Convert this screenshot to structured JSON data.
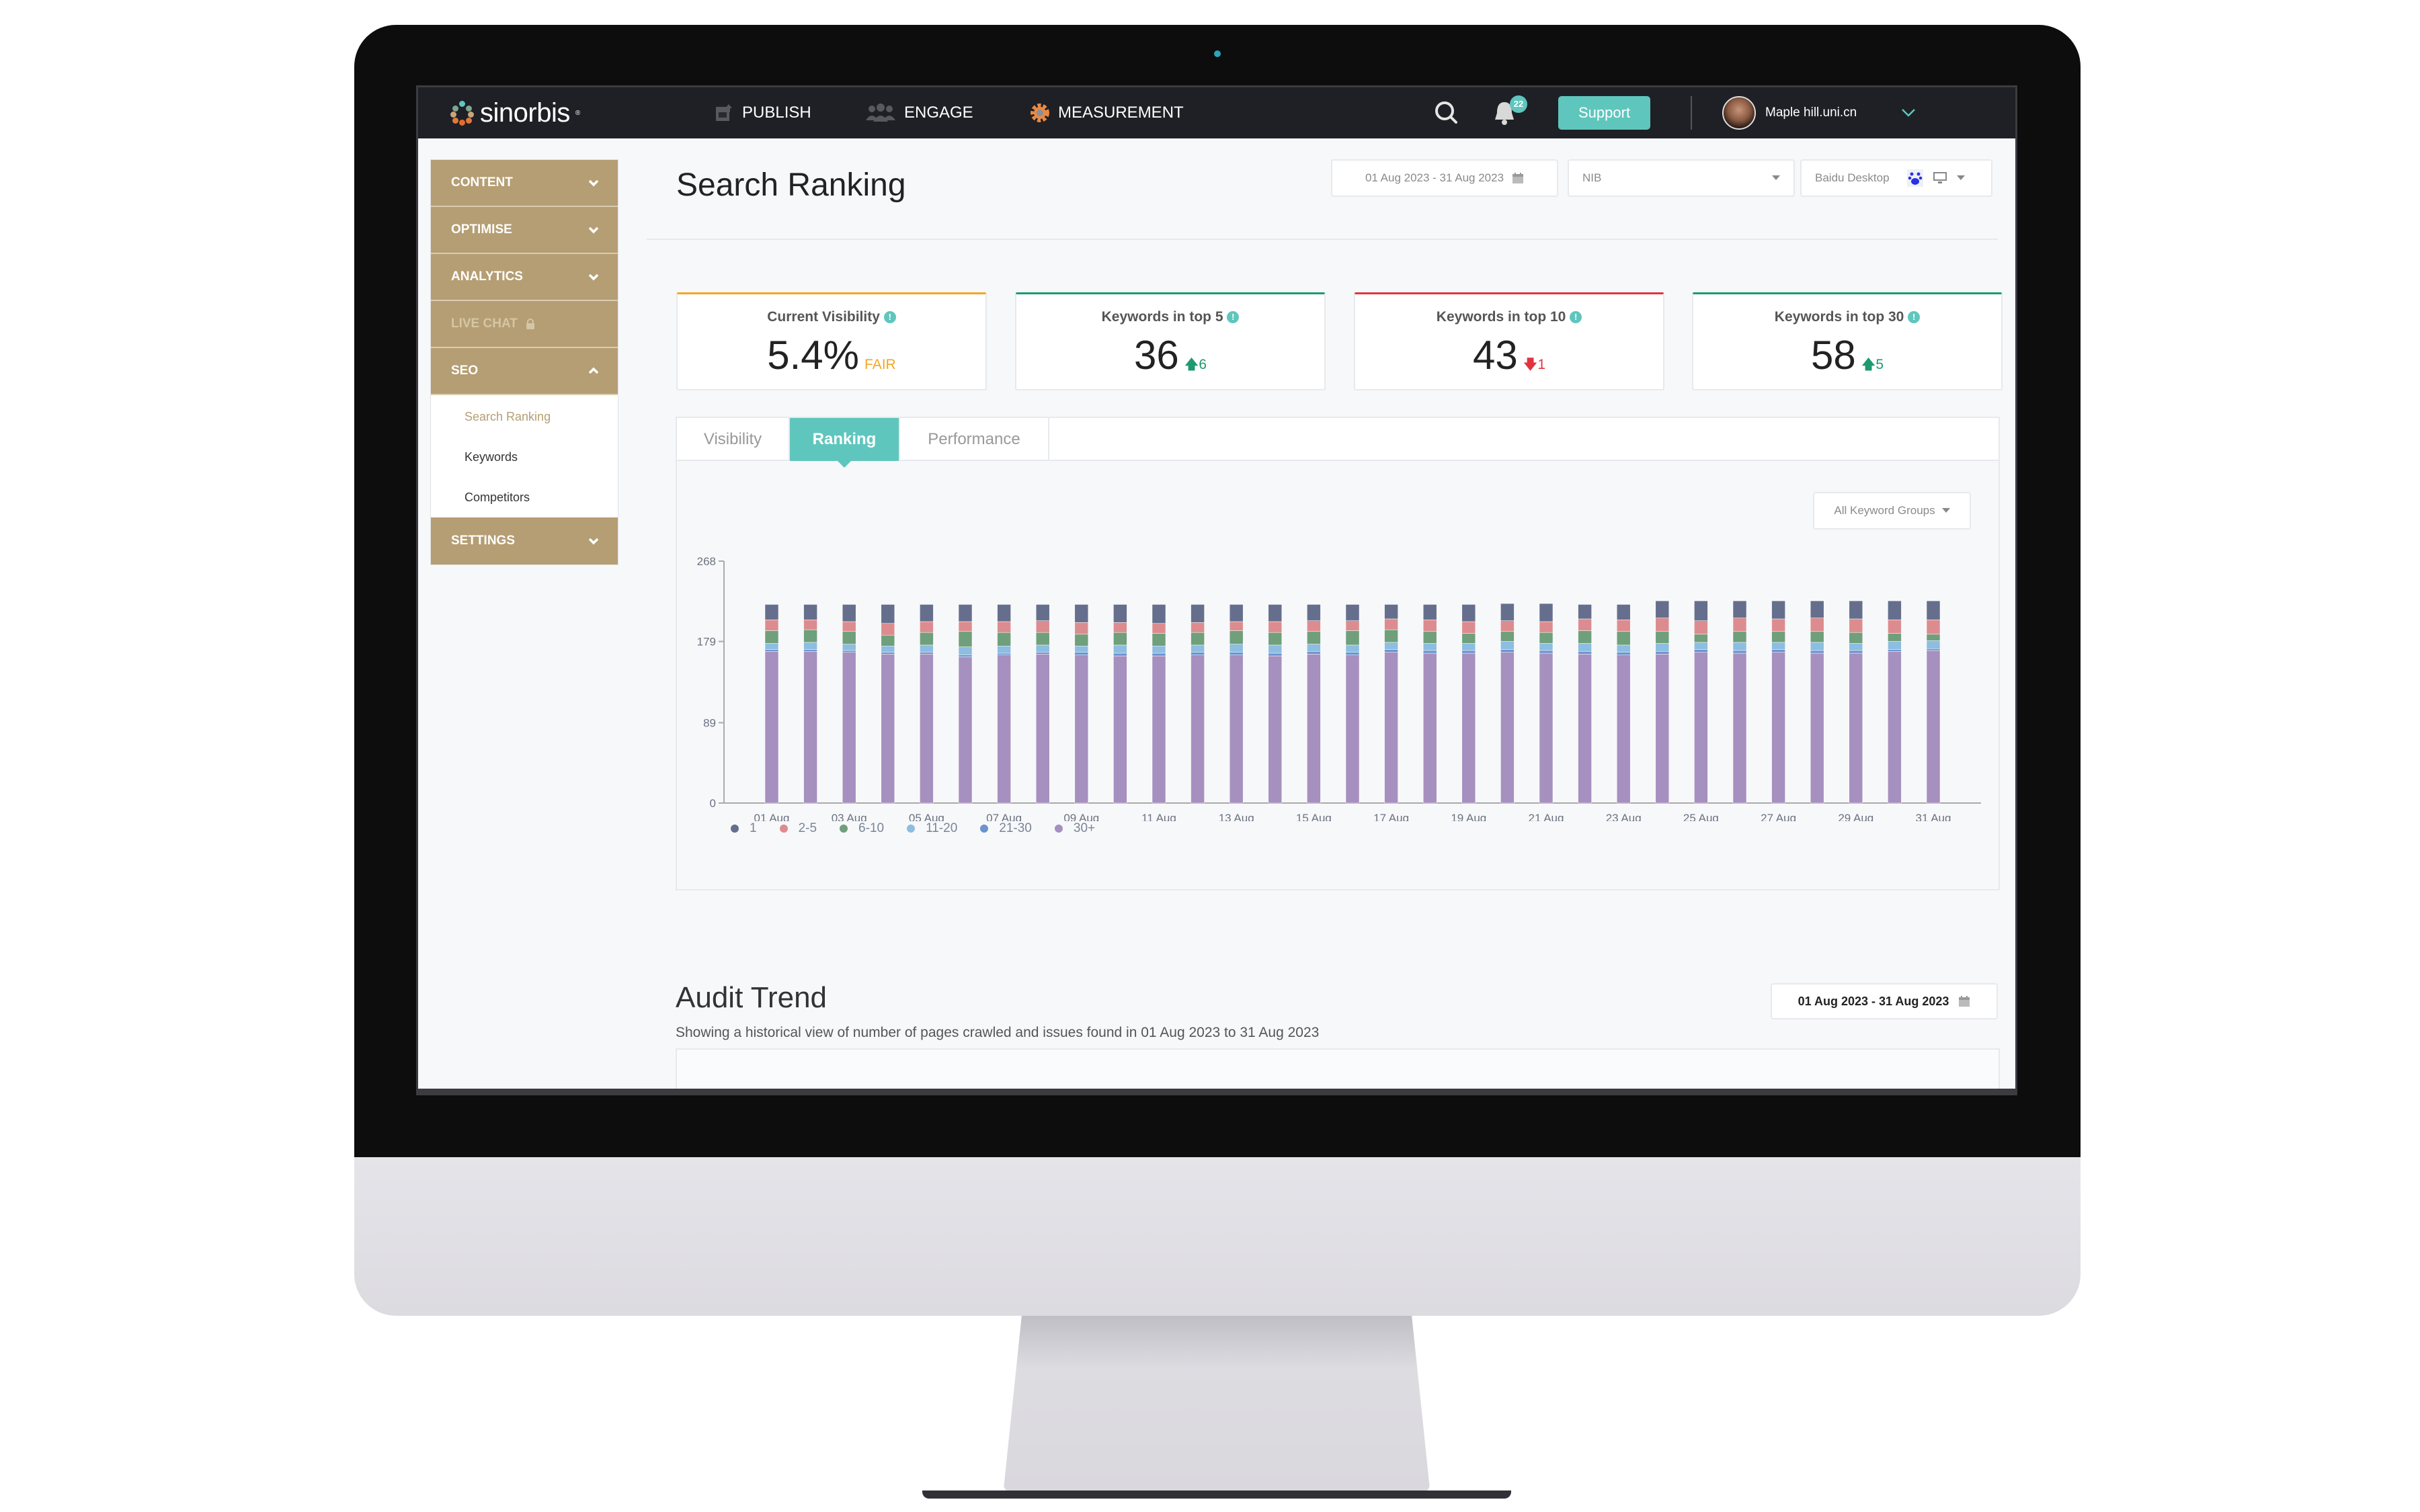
{
  "topnav": {
    "brand": "sinorbis",
    "brand_mark": "®",
    "items": [
      {
        "label": "PUBLISH",
        "icon": "publish-icon"
      },
      {
        "label": "ENGAGE",
        "icon": "engage-icon"
      },
      {
        "label": "MEASUREMENT",
        "icon": "gear-icon"
      }
    ],
    "notifications_count": "22",
    "support_label": "Support",
    "user_name": "Maple hill.uni.cn"
  },
  "sidebar": {
    "items": [
      {
        "label": "CONTENT",
        "state": "collapsed"
      },
      {
        "label": "OPTIMISE",
        "state": "collapsed"
      },
      {
        "label": "ANALYTICS",
        "state": "collapsed"
      },
      {
        "label": "LIVE CHAT",
        "state": "locked"
      },
      {
        "label": "SEO",
        "state": "expanded"
      },
      {
        "label": "SETTINGS",
        "state": "collapsed"
      }
    ],
    "seo_subitems": [
      {
        "label": "Search Ranking",
        "active": true
      },
      {
        "label": "Keywords",
        "active": false
      },
      {
        "label": "Competitors",
        "active": false
      }
    ]
  },
  "page": {
    "title": "Search Ranking",
    "filters": {
      "date_range": "01 Aug 2023 - 31 Aug 2023",
      "site": "NIB",
      "engine": "Baidu Desktop"
    }
  },
  "cards": [
    {
      "title": "Current Visibility",
      "value": "5.4%",
      "delta": "FAIR",
      "delta_dir": "none",
      "accent": "#f5a623",
      "delta_color": "#f5a623"
    },
    {
      "title": "Keywords in top 5",
      "value": "36",
      "delta": "6",
      "delta_dir": "up",
      "accent": "#1e9a6e",
      "delta_color": "#1e9a6e"
    },
    {
      "title": "Keywords in top 10",
      "value": "43",
      "delta": "1",
      "delta_dir": "down",
      "accent": "#e0343f",
      "delta_color": "#e0343f"
    },
    {
      "title": "Keywords in top 30",
      "value": "58",
      "delta": "5",
      "delta_dir": "up",
      "accent": "#1e9a6e",
      "delta_color": "#1e9a6e"
    }
  ],
  "tabs": [
    {
      "label": "Visibility",
      "active": false
    },
    {
      "label": "Ranking",
      "active": true
    },
    {
      "label": "Performance",
      "active": false
    }
  ],
  "keyword_group_select": "All Keyword Groups",
  "colors": {
    "accent": "#5fc6bd",
    "sidebar": "#b59e73"
  },
  "chart_data": {
    "type": "bar",
    "stacked": true,
    "title": "",
    "xlabel": "",
    "ylabel": "",
    "ylim": [
      0,
      268
    ],
    "yticks": [
      0,
      89,
      179,
      268
    ],
    "grid": false,
    "legend_position": "bottom-left",
    "categories": [
      "01 Aug",
      "02 Aug",
      "03 Aug",
      "04 Aug",
      "05 Aug",
      "06 Aug",
      "07 Aug",
      "08 Aug",
      "09 Aug",
      "10 Aug",
      "11 Aug",
      "12 Aug",
      "13 Aug",
      "14 Aug",
      "15 Aug",
      "16 Aug",
      "17 Aug",
      "18 Aug",
      "19 Aug",
      "20 Aug",
      "21 Aug",
      "22 Aug",
      "23 Aug",
      "24 Aug",
      "25 Aug",
      "26 Aug",
      "27 Aug",
      "28 Aug",
      "29 Aug",
      "30 Aug",
      "31 Aug"
    ],
    "xtick_labels": [
      "01 Aug",
      "03 Aug",
      "05 Aug",
      "07 Aug",
      "09 Aug",
      "11 Aug",
      "13 Aug",
      "15 Aug",
      "17 Aug",
      "19 Aug",
      "21 Aug",
      "23 Aug",
      "25 Aug",
      "27 Aug",
      "29 Aug",
      "31 Aug"
    ],
    "series": [
      {
        "name": "30+",
        "color": "#a690bf",
        "values": [
          168,
          168,
          167,
          165,
          165,
          162,
          164,
          165,
          164,
          163,
          163,
          164,
          164,
          163,
          165,
          164,
          167,
          166,
          166,
          167,
          166,
          165,
          164,
          165,
          167,
          166,
          167,
          166,
          166,
          168,
          169
        ]
      },
      {
        "name": "21-30",
        "color": "#6b93d0",
        "values": [
          2,
          2,
          2,
          2,
          2,
          2,
          2,
          2,
          3,
          3,
          3,
          3,
          3,
          3,
          3,
          3,
          3,
          3,
          3,
          3,
          3,
          3,
          3,
          3,
          3,
          3,
          3,
          3,
          3,
          2,
          2
        ]
      },
      {
        "name": "11-20",
        "color": "#8dbde0",
        "values": [
          7,
          8,
          7,
          7,
          8,
          9,
          8,
          8,
          7,
          9,
          8,
          8,
          9,
          9,
          8,
          8,
          8,
          8,
          8,
          9,
          8,
          9,
          8,
          9,
          8,
          9,
          8,
          9,
          8,
          9,
          9
        ]
      },
      {
        "name": "6-10",
        "color": "#6f9f7b",
        "values": [
          14,
          14,
          14,
          12,
          14,
          17,
          15,
          14,
          13,
          14,
          14,
          14,
          15,
          14,
          14,
          16,
          14,
          13,
          11,
          11,
          12,
          14,
          15,
          13,
          9,
          12,
          12,
          12,
          12,
          9,
          7
        ]
      },
      {
        "name": "2-5",
        "color": "#dc8c8f",
        "values": [
          12,
          11,
          11,
          13,
          12,
          11,
          12,
          13,
          13,
          11,
          11,
          11,
          10,
          12,
          12,
          11,
          12,
          13,
          13,
          12,
          12,
          13,
          13,
          15,
          15,
          15,
          14,
          15,
          15,
          15,
          16
        ]
      },
      {
        "name": "1",
        "color": "#656f8d",
        "values": [
          17,
          17,
          19,
          21,
          19,
          19,
          19,
          18,
          20,
          20,
          21,
          20,
          19,
          19,
          18,
          18,
          16,
          17,
          19,
          19,
          20,
          16,
          17,
          19,
          22,
          19,
          20,
          19,
          20,
          21,
          21
        ]
      }
    ]
  },
  "audit": {
    "title": "Audit Trend",
    "subtitle": "Showing a historical view of number of pages crawled and issues found in 01 Aug 2023 to 31 Aug 2023",
    "date_range": "01 Aug 2023 - 31 Aug 2023"
  }
}
